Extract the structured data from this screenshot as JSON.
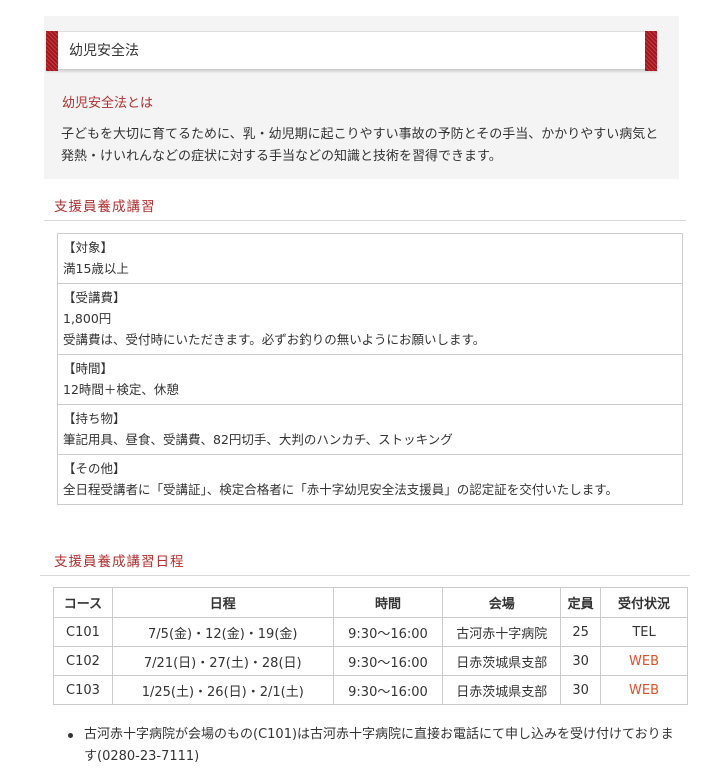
{
  "header": {
    "title": "幼児安全法"
  },
  "intro": {
    "heading": "幼児安全法とは",
    "body": "子どもを大切に育てるために、乳・幼児期に起こりやすい事故の予防とその手当、かかりやすい病気と発熱・けいれんなどの症状に対する手当などの知識と技術を習得できます。"
  },
  "course": {
    "heading": "支援員養成講習",
    "items": [
      {
        "label": "【対象】",
        "lines": [
          "満15歳以上"
        ]
      },
      {
        "label": "【受講費】",
        "lines": [
          "1,800円",
          "受講費は、受付時にいただきます。必ずお釣りの無いようにお願いします。"
        ]
      },
      {
        "label": "【時間】",
        "lines": [
          "12時間＋検定、休憩"
        ]
      },
      {
        "label": "【持ち物】",
        "lines": [
          "筆記用具、昼食、受講費、82円切手、大判のハンカチ、ストッキング"
        ]
      },
      {
        "label": "【その他】",
        "lines": [
          "全日程受講者に「受講証」、検定合格者に「赤十字幼児安全法支援員」の認定証を交付いたします。"
        ]
      }
    ]
  },
  "schedule": {
    "heading": "支援員養成講習日程",
    "columns": [
      "コース",
      "日程",
      "時間",
      "会場",
      "定員",
      "受付状況"
    ],
    "rows": [
      {
        "course": "C101",
        "dates": "7/5(金)・12(金)・19(金)",
        "time": "9:30～16:00",
        "venue": "古河赤十字病院",
        "capacity": "25",
        "status": "TEL"
      },
      {
        "course": "C102",
        "dates": "7/21(日)・27(土)・28(日)",
        "time": "9:30～16:00",
        "venue": "日赤茨城県支部",
        "capacity": "30",
        "status": "WEB"
      },
      {
        "course": "C103",
        "dates": "1/25(土)・26(日)・2/1(土)",
        "time": "9:30～16:00",
        "venue": "日赤茨城県支部",
        "capacity": "30",
        "status": "WEB"
      }
    ]
  },
  "notes": [
    "古河赤十字病院が会場のもの(C101)は古河赤十字病院に直接お電話にて申し込みを受け付けております(0280-23-7111)"
  ],
  "colors": {
    "accent_red": "#b03030",
    "cap_red": "#a8141c",
    "web_link": "#d9532a"
  }
}
